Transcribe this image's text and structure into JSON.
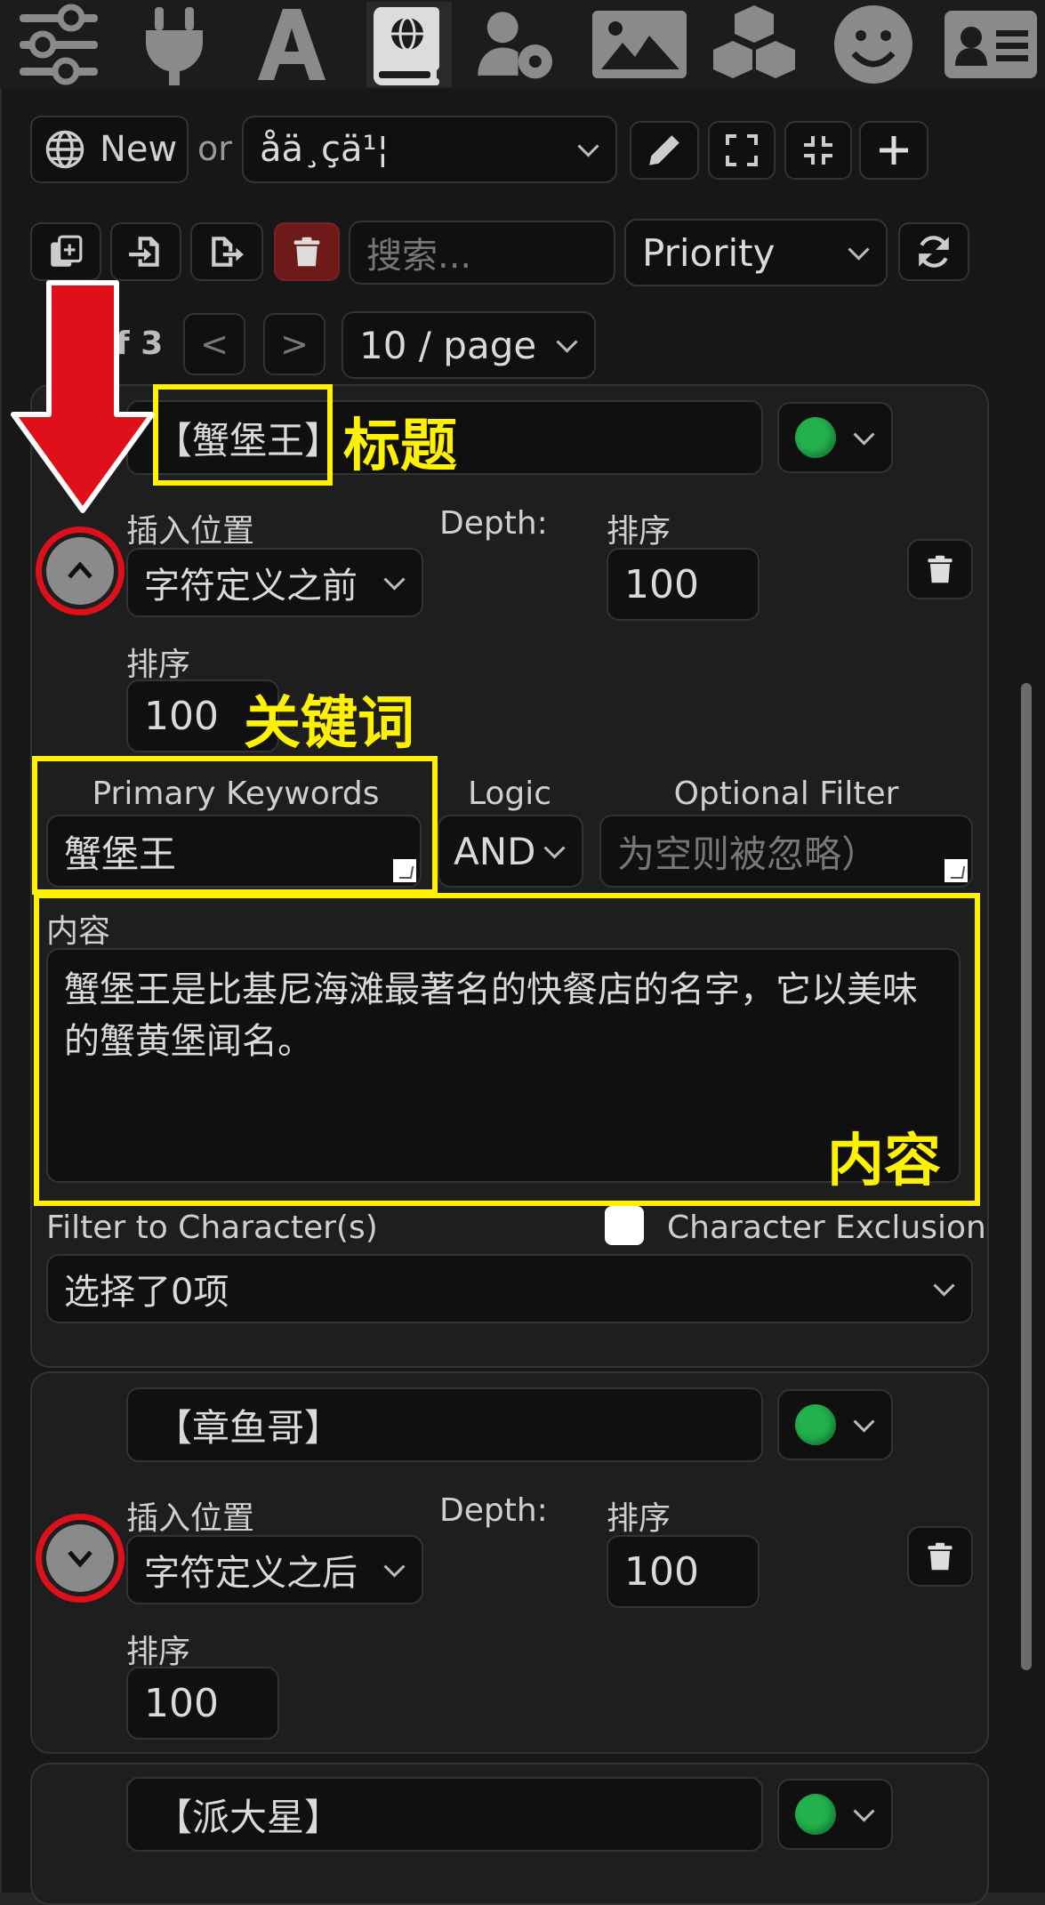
{
  "top_icons": [
    "sliders-icon",
    "plug-icon",
    "font-icon",
    "world-book-icon",
    "user-settings-icon",
    "image-icon",
    "cubes-icon",
    "smiley-icon",
    "id-card-icon"
  ],
  "toolbar": {
    "new_label": "New",
    "or_label": "or",
    "book_select_value": "åä¸çä¹¦"
  },
  "toolbar2": {
    "search_placeholder": "搜索...",
    "sort_value": "Priority"
  },
  "pagination": {
    "of_label": "f 3",
    "prev_label": "<",
    "next_label": ">",
    "per_page_value": "10 / page"
  },
  "labels": {
    "insert_position": "插入位置",
    "depth": "Depth:",
    "order": "排序",
    "primary_keywords": "Primary Keywords",
    "logic": "Logic",
    "optional_filter": "Optional Filter",
    "content": "内容",
    "filter_to_characters": "Filter to Character(s)",
    "character_exclusion": "Character Exclusion"
  },
  "entries": [
    {
      "title": "【蟹堡王】",
      "position": "字符定义之前",
      "order_value": "100",
      "order2_value": "100",
      "keywords": "蟹堡王",
      "logic": "AND",
      "optional_filter_placeholder": "为空则被忽略）",
      "content": "蟹堡王是比基尼海滩最著名的快餐店的名字，它以美味的蟹黄堡闻名。",
      "character_filter_value": "选择了0项"
    },
    {
      "title": "【章鱼哥】",
      "position": "字符定义之后",
      "order_value": "100",
      "order2_value": "100"
    },
    {
      "title": "【派大星】"
    }
  ],
  "annotations": {
    "title": "标题",
    "keywords": "关键词",
    "content": "内容"
  },
  "colors": {
    "status_green": "#22b14c",
    "annotation_yellow": "#fff200",
    "annotation_red": "#e0101a",
    "delete_red": "#6e1a1a"
  }
}
